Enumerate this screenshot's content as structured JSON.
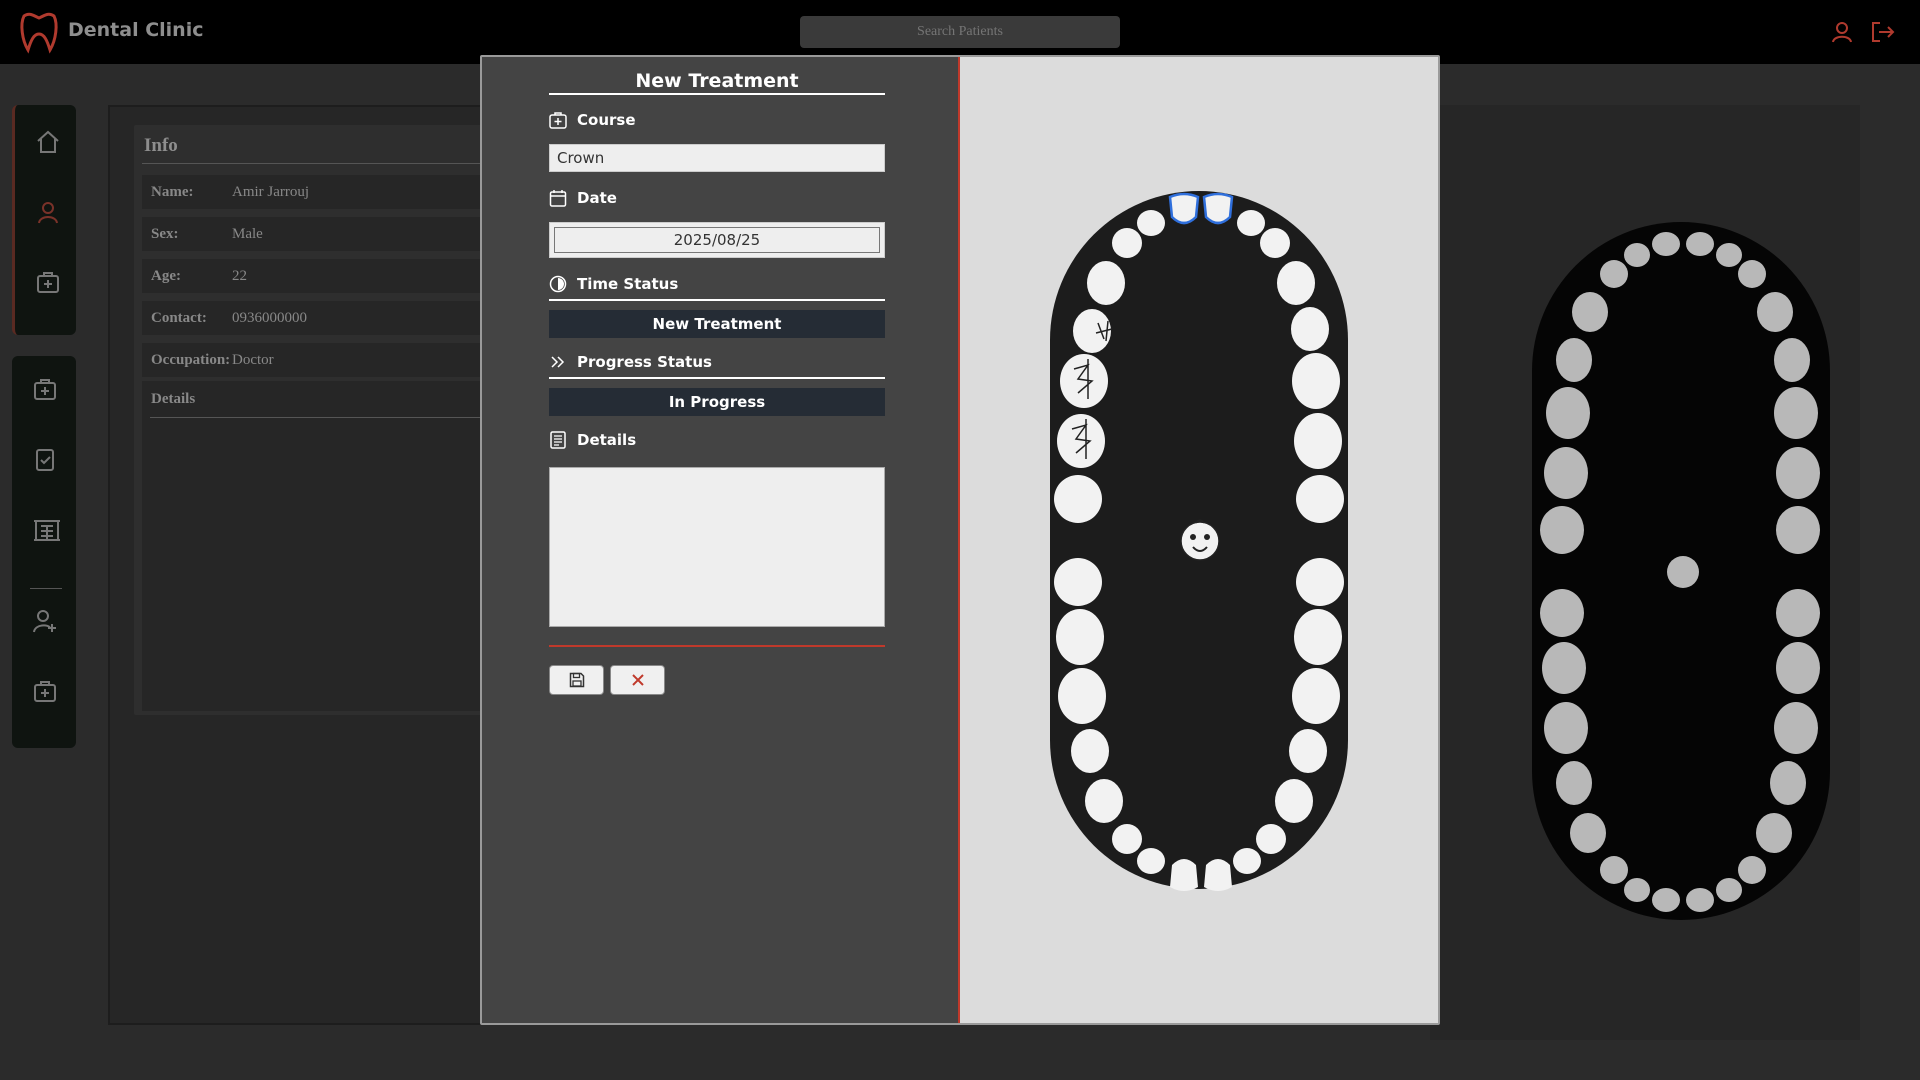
{
  "app": {
    "brand": "Dental Clinic",
    "search_placeholder": "Search Patients"
  },
  "info": {
    "title": "Info",
    "rows": [
      {
        "key": "Name:",
        "value": "Amir Jarrouj"
      },
      {
        "key": "Sex:",
        "value": "Male"
      },
      {
        "key": "Age:",
        "value": "22"
      },
      {
        "key": "Contact:",
        "value": "0936000000"
      },
      {
        "key": "Occupation:",
        "value": "Doctor"
      }
    ],
    "details_label": "Details"
  },
  "modal": {
    "title": "New Treatment",
    "course_label": "Course",
    "course_value": "Crown",
    "date_label": "Date",
    "date_value": "2025/08/25",
    "time_status_label": "Time Status",
    "time_status_value": "New Treatment",
    "progress_status_label": "Progress Status",
    "progress_status_value": "In Progress",
    "details_label": "Details",
    "details_value": ""
  },
  "colors": {
    "accent": "#c0392b",
    "select_bg": "#252c35",
    "selected_tooth": "#2f6fdc"
  },
  "icons": [
    "tooth-logo-icon",
    "user-icon",
    "logout-icon",
    "home-icon",
    "patient-icon",
    "treatment-icon",
    "clipboard-icon",
    "building-icon",
    "add-user-icon",
    "add-treatment-icon",
    "save-icon",
    "close-icon",
    "baby-face-icon"
  ]
}
